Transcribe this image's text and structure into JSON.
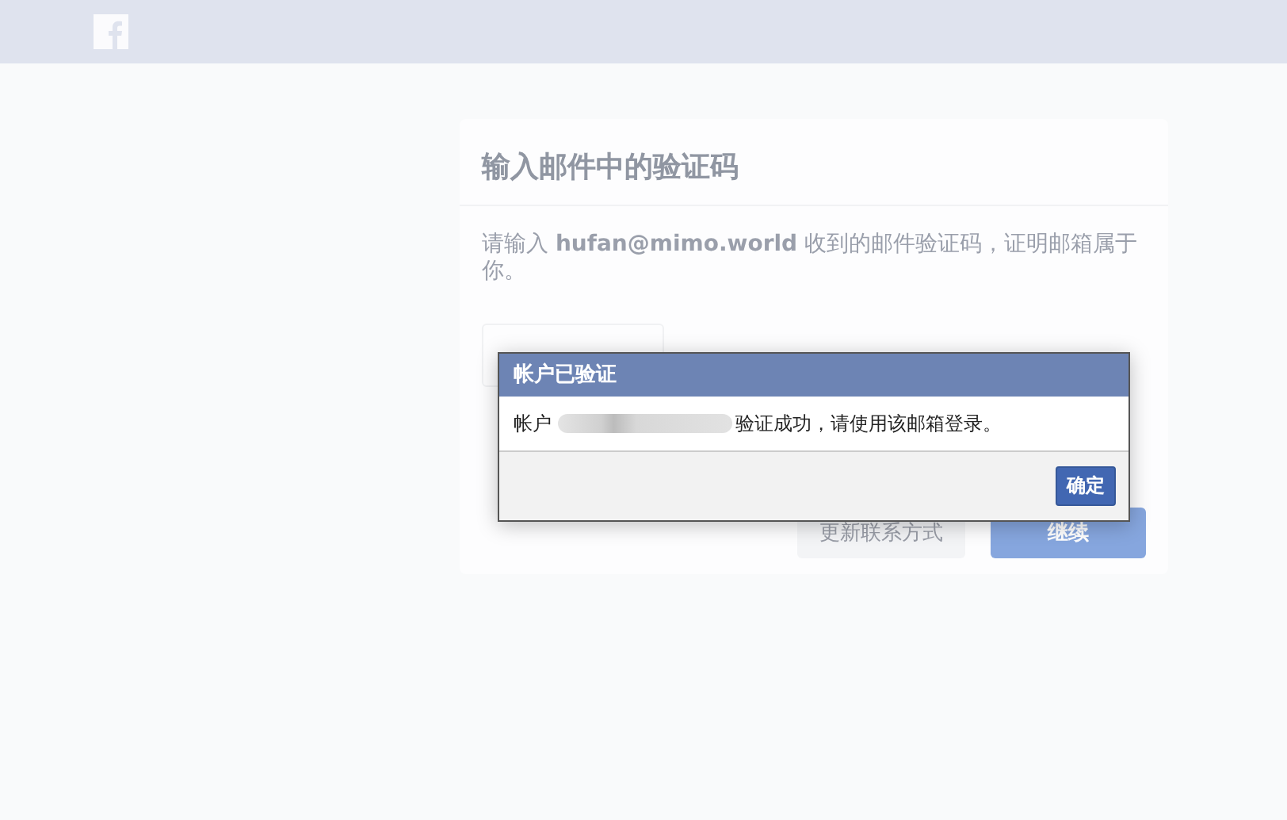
{
  "card": {
    "title": "输入邮件中的验证码",
    "description": "请输入 **hufan@mimo.world** 收到的邮件验证码，证明邮箱属于你。",
    "buttons": [
      {
        "label": "更新联系方式",
        "kind": "secondary"
      },
      {
        "label": "继续",
        "kind": "primary"
      }
    ]
  },
  "dialog": {
    "title": "帐户已验证",
    "message_before": "帐户",
    "message_after": "验证成功，请使用该邮箱登录。",
    "button": "确定"
  }
}
